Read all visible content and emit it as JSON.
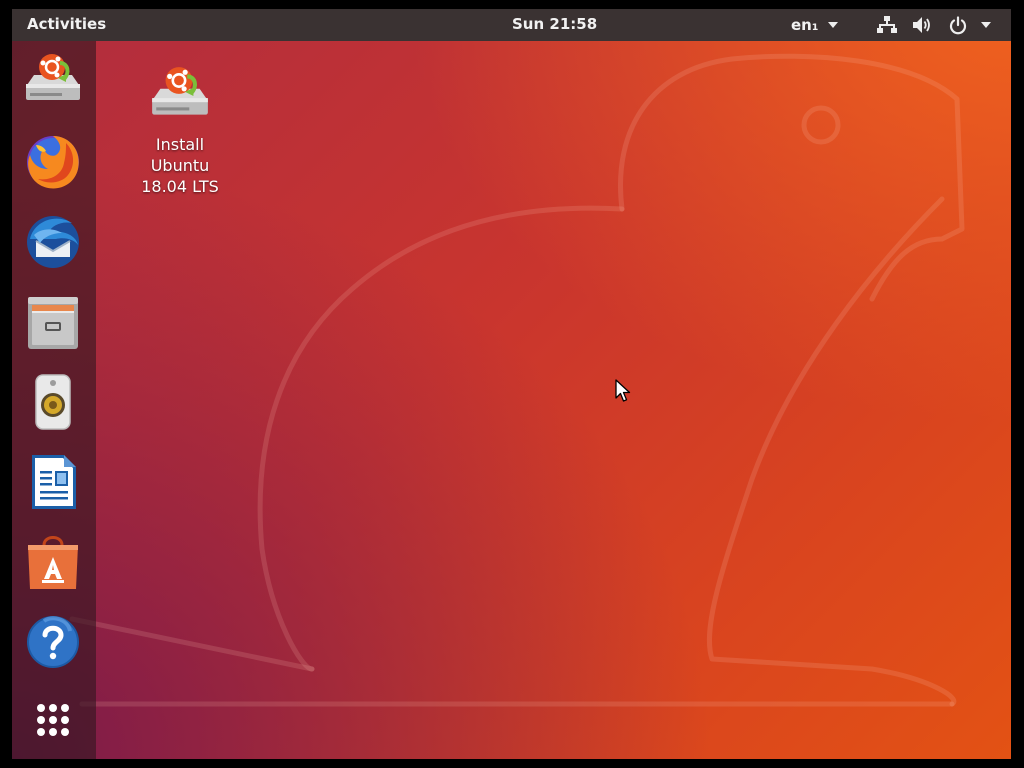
{
  "topbar": {
    "activities_label": "Activities",
    "clock": "Sun 21:58",
    "keyboard_layout": "en₁",
    "tray_icons": [
      "network-icon",
      "volume-icon",
      "power-icon",
      "chevron-down-icon"
    ]
  },
  "dock": {
    "items": [
      {
        "name": "install-ubuntu-launcher",
        "icon": "installer-icon"
      },
      {
        "name": "firefox-launcher",
        "icon": "firefox-icon"
      },
      {
        "name": "thunderbird-launcher",
        "icon": "thunderbird-icon"
      },
      {
        "name": "files-launcher",
        "icon": "file-cabinet-icon"
      },
      {
        "name": "rhythmbox-launcher",
        "icon": "speaker-icon"
      },
      {
        "name": "libreoffice-writer-launcher",
        "icon": "document-icon"
      },
      {
        "name": "ubuntu-software-launcher",
        "icon": "shopping-bag-icon"
      },
      {
        "name": "help-launcher",
        "icon": "question-icon"
      },
      {
        "name": "show-applications-button",
        "icon": "app-grid-icon"
      }
    ]
  },
  "desktop": {
    "icons": [
      {
        "label": "Install\nUbuntu\n18.04 LTS",
        "icon": "installer-icon"
      }
    ]
  },
  "colors": {
    "topbar": "#3a3232",
    "wallpaper_start": "#b02c3f",
    "wallpaper_end": "#e35214",
    "ubuntu_orange": "#e95420"
  }
}
